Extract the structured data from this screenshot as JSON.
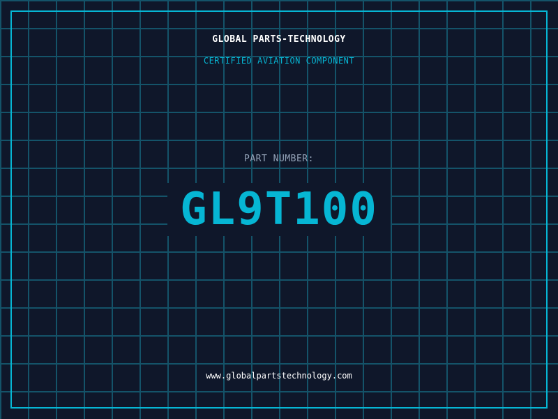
{
  "company": "GLOBAL PARTS-TECHNOLOGY",
  "subtitle": "CERTIFIED AVIATION COMPONENT",
  "part_label": "PART NUMBER:",
  "part_number": "GL9T100",
  "website": "www.globalpartstechnology.com",
  "colors": {
    "background": "#0f172a",
    "accent": "#06b6d4",
    "grid": "#155e75"
  }
}
